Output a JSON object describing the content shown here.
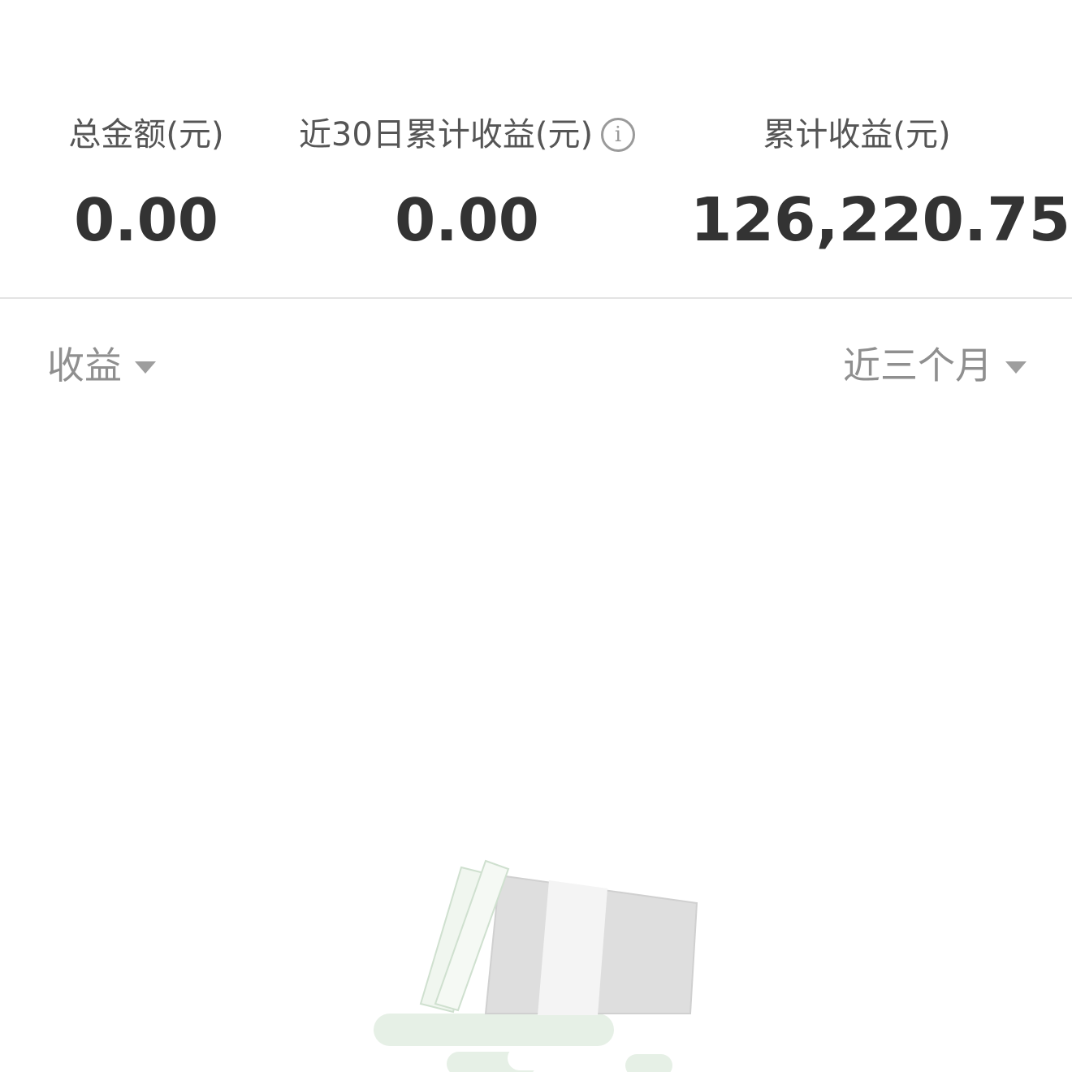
{
  "summary": {
    "total_amount": {
      "label": "总金额(元)",
      "value": "0.00"
    },
    "recent_30d_income": {
      "label": "近30日累计收益(元)",
      "value": "0.00",
      "icon": "info-icon"
    },
    "cumulative_income": {
      "label": "累计收益(元)",
      "value": "126,220.75"
    }
  },
  "filters": {
    "type": {
      "selected": "收益",
      "icon": "caret-down-icon"
    },
    "range": {
      "selected": "近三个月",
      "icon": "caret-down-icon"
    }
  },
  "empty_state": {
    "illustration": "empty-box-icon"
  },
  "colors": {
    "label": "#555555",
    "value": "#333333",
    "filter": "#8f8f8f",
    "divider": "#e3e3e3",
    "illustration_green": "#e6f0e6",
    "illustration_gray": "#dedede"
  }
}
